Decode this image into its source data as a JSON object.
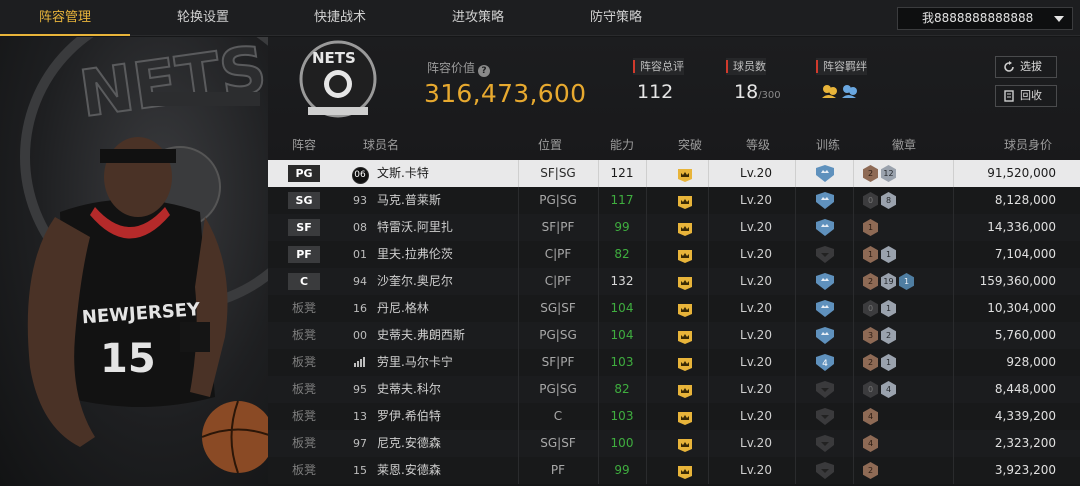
{
  "nav": {
    "tabs": [
      "阵容管理",
      "轮换设置",
      "快捷战术",
      "进攻策略",
      "防守策略"
    ],
    "active_tab": "阵容管理",
    "account": "我8888888888888"
  },
  "header": {
    "value_label": "阵容价值",
    "value": "316,473,600",
    "rating_label": "阵容总评",
    "rating": "112",
    "count_label": "球员数",
    "count": "18",
    "count_max": "/300",
    "bond_label": "阵容羁绊",
    "btn_select": "选拔",
    "btn_recycle": "回收"
  },
  "table": {
    "headers": {
      "lineup": "阵容",
      "name": "球员名",
      "position": "位置",
      "ability": "能力",
      "breakthrough": "突破",
      "level": "等级",
      "training": "训练",
      "badge": "徽章",
      "worth": "球员身价"
    },
    "rows": [
      {
        "slot": "PG",
        "num": "06",
        "name": "文斯.卡特",
        "pos": "SF|SG",
        "ability": "121",
        "level": "Lv.20",
        "train": "blue",
        "badges": [
          "2",
          "12"
        ],
        "worth": "91,520,000",
        "selected": true
      },
      {
        "slot": "SG",
        "num": "93",
        "name": "马克.普莱斯",
        "pos": "PG|SG",
        "ability": "117",
        "level": "Lv.20",
        "train": "blue",
        "badges": [
          "0",
          "8"
        ],
        "worth": "8,128,000"
      },
      {
        "slot": "SF",
        "num": "08",
        "name": "特雷沃.阿里扎",
        "pos": "SF|PF",
        "ability": "99",
        "level": "Lv.20",
        "train": "blue",
        "badges": [
          "1"
        ],
        "worth": "14,336,000"
      },
      {
        "slot": "PF",
        "num": "01",
        "name": "里夫.拉弗伦茨",
        "pos": "C|PF",
        "ability": "82",
        "level": "Lv.20",
        "train": "dark",
        "badges": [
          "1",
          "1"
        ],
        "worth": "7,104,000"
      },
      {
        "slot": "C",
        "num": "94",
        "name": "沙奎尔.奥尼尔",
        "pos": "C|PF",
        "ability": "132",
        "level": "Lv.20",
        "train": "blue",
        "badges": [
          "2",
          "19",
          "1"
        ],
        "worth": "159,360,000"
      },
      {
        "slot": "板凳",
        "num": "16",
        "name": "丹尼.格林",
        "pos": "SG|SF",
        "ability": "104",
        "level": "Lv.20",
        "train": "blue",
        "badges": [
          "0",
          "1"
        ],
        "worth": "10,304,000"
      },
      {
        "slot": "板凳",
        "num": "00",
        "name": "史蒂夫.弗朗西斯",
        "pos": "PG|SG",
        "ability": "104",
        "level": "Lv.20",
        "train": "blue",
        "badges": [
          "3",
          "2"
        ],
        "worth": "5,760,000"
      },
      {
        "slot": "板凳",
        "num": "",
        "name": "劳里.马尔卡宁",
        "pos": "SF|PF",
        "ability": "103",
        "level": "Lv.20",
        "train": "blue4",
        "badges": [
          "2",
          "1"
        ],
        "worth": "928,000"
      },
      {
        "slot": "板凳",
        "num": "95",
        "name": "史蒂夫.科尔",
        "pos": "PG|SG",
        "ability": "82",
        "level": "Lv.20",
        "train": "dark",
        "badges": [
          "0",
          "4"
        ],
        "worth": "8,448,000"
      },
      {
        "slot": "板凳",
        "num": "13",
        "name": "罗伊.希伯特",
        "pos": "C",
        "ability": "103",
        "level": "Lv.20",
        "train": "dark",
        "badges": [
          "4"
        ],
        "worth": "4,339,200"
      },
      {
        "slot": "板凳",
        "num": "97",
        "name": "尼克.安德森",
        "pos": "SG|SF",
        "ability": "100",
        "level": "Lv.20",
        "train": "dark",
        "badges": [
          "4"
        ],
        "worth": "2,323,200"
      },
      {
        "slot": "板凳",
        "num": "15",
        "name": "莱恩.安德森",
        "pos": "PF",
        "ability": "99",
        "level": "Lv.20",
        "train": "dark",
        "badges": [
          "2"
        ],
        "worth": "3,923,200"
      }
    ]
  },
  "hero": {
    "team_word": "NETS",
    "jersey_text": "NEWJERSEY",
    "jersey_number": "15"
  },
  "colors": {
    "accent": "#e8b43a",
    "value_gold": "#e7a92f",
    "ability_green": "#3fae3f",
    "label_red": "#d13a2c"
  }
}
